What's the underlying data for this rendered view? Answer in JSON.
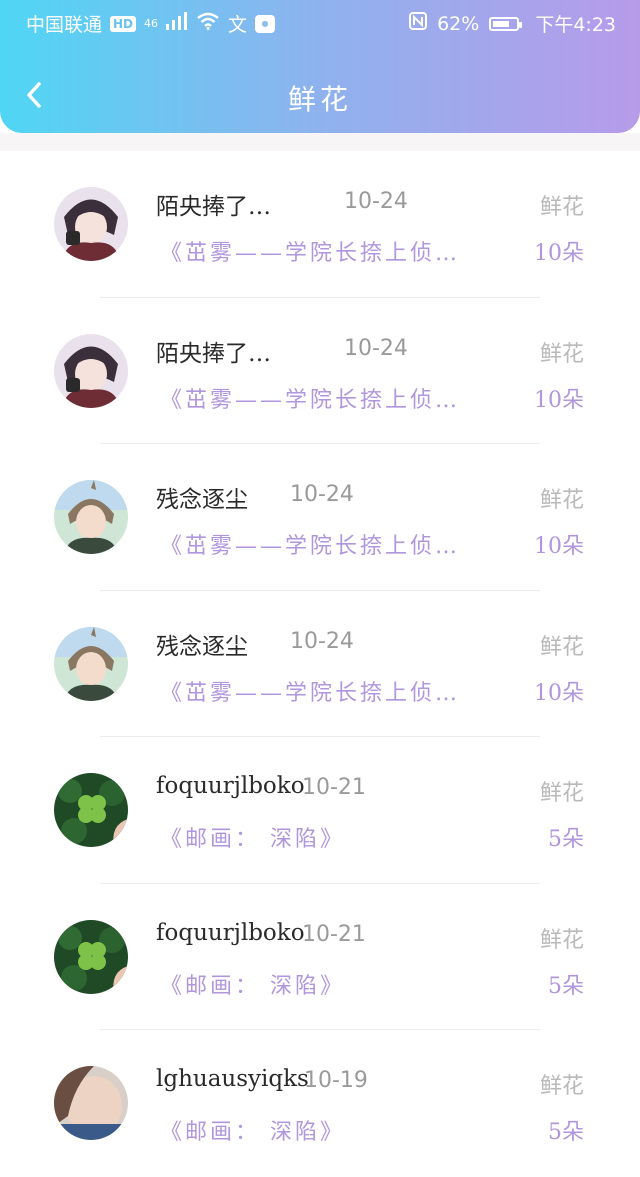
{
  "status_bar": {
    "carrier": "中国联通",
    "hd": "HD",
    "network": "46",
    "battery": "62%",
    "time": "下午4:23"
  },
  "header": {
    "title": "鲜花"
  },
  "records": [
    {
      "name": "陌央捧了…",
      "date": "10-24",
      "type": "鲜花",
      "book": "《茁雾——学院长捺上侦…",
      "amount": "10朵"
    },
    {
      "name": "陌央捧了…",
      "date": "10-24",
      "type": "鲜花",
      "book": "《茁雾——学院长捺上侦…",
      "amount": "10朵"
    },
    {
      "name": "残念逐尘",
      "date": "10-24",
      "type": "鲜花",
      "book": "《茁雾——学院长捺上侦…",
      "amount": "10朵"
    },
    {
      "name": "残念逐尘",
      "date": "10-24",
      "type": "鲜花",
      "book": "《茁雾——学院长捺上侦…",
      "amount": "10朵"
    },
    {
      "name": "foquurjlboko",
      "date": "10-21",
      "type": "鲜花",
      "book": "《邮画： 深陷》",
      "amount": "5朵"
    },
    {
      "name": "foquurjlboko",
      "date": "10-21",
      "type": "鲜花",
      "book": "《邮画： 深陷》",
      "amount": "5朵"
    },
    {
      "name": "lghuausyiqks",
      "date": "10-19",
      "type": "鲜花",
      "book": "《邮画： 深陷》",
      "amount": "5朵"
    }
  ],
  "colors": {
    "header_gradient_start": "#4fd6f4",
    "header_gradient_end": "#b79be9",
    "book_text": "#b096dc",
    "type_text": "#b9b9b9"
  }
}
